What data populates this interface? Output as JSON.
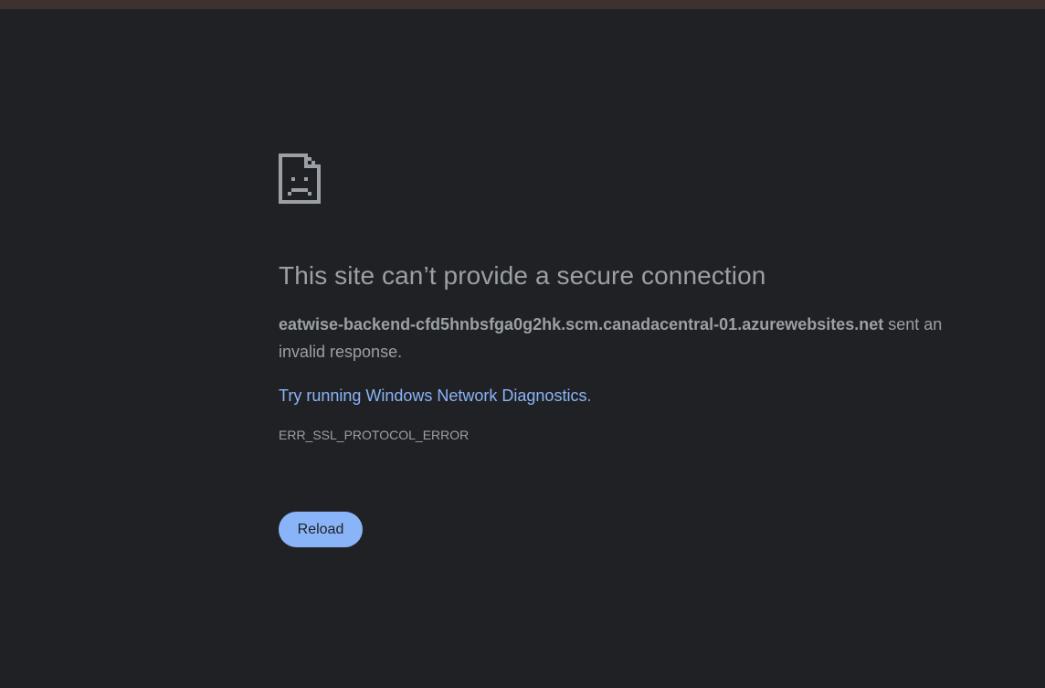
{
  "error": {
    "icon": "sad-page-icon",
    "title": "This site can’t provide a secure connection",
    "host": "eatwise-backend-cfd5hnbsfga0g2hk.scm.canadacentral-01.azurewebsites.net",
    "summary_suffix": " sent an invalid response.",
    "suggestion_link": "Try running Windows Network Diagnostics",
    "suggestion_suffix": ".",
    "code": "ERR_SSL_PROTOCOL_ERROR",
    "reload_label": "Reload"
  },
  "colors": {
    "background": "#202124",
    "text": "#9aa0a6",
    "link": "#8ab4f8",
    "button": "#8ab4f8",
    "top_strip": "#3d3230"
  }
}
